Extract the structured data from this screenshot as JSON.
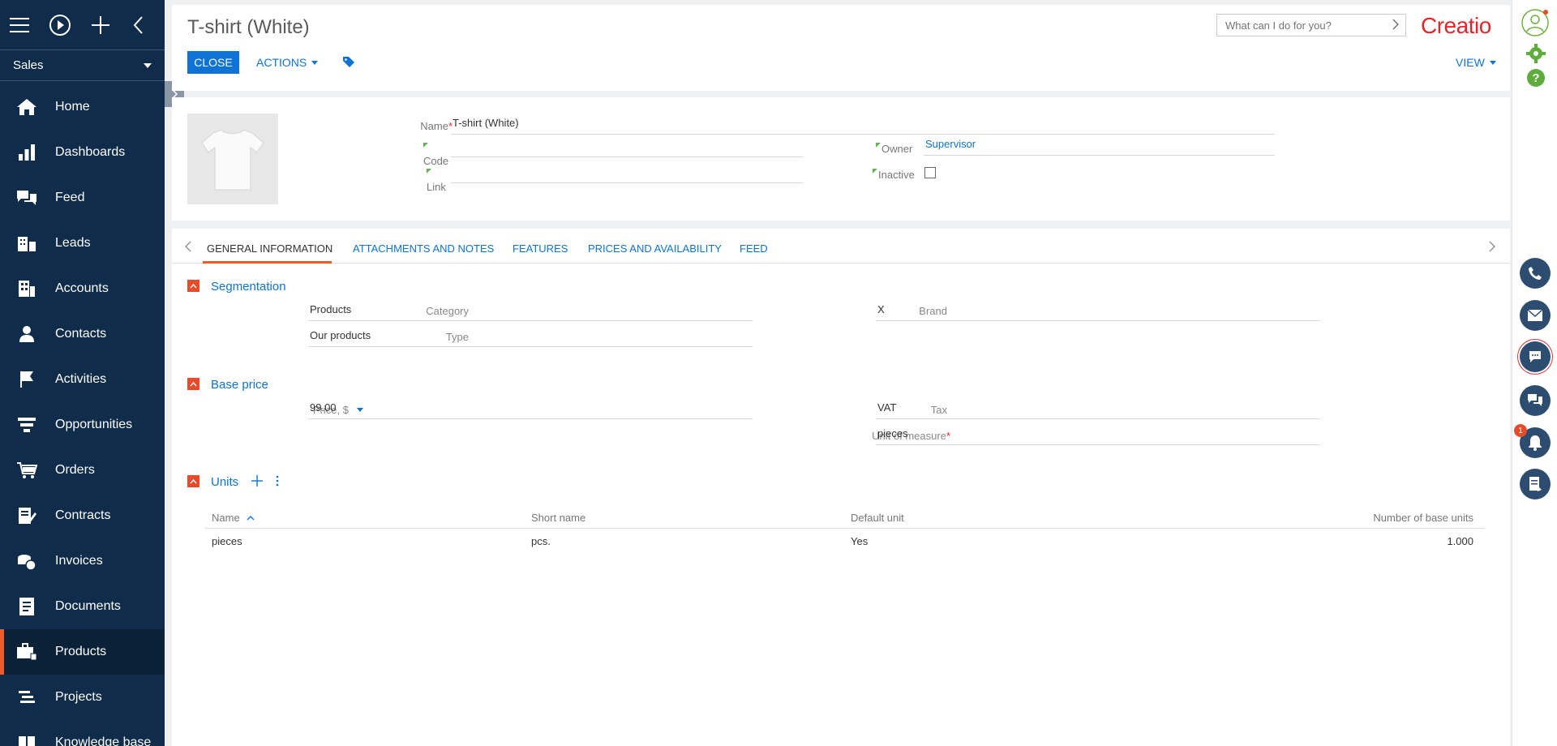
{
  "sidebar": {
    "workspace": "Sales",
    "items": [
      {
        "label": "Home"
      },
      {
        "label": "Dashboards"
      },
      {
        "label": "Feed"
      },
      {
        "label": "Leads"
      },
      {
        "label": "Accounts"
      },
      {
        "label": "Contacts"
      },
      {
        "label": "Activities"
      },
      {
        "label": "Opportunities"
      },
      {
        "label": "Orders"
      },
      {
        "label": "Contracts"
      },
      {
        "label": "Invoices"
      },
      {
        "label": "Documents"
      },
      {
        "label": "Products",
        "active": true
      },
      {
        "label": "Projects"
      },
      {
        "label": "Knowledge base"
      }
    ]
  },
  "header": {
    "title": "T-shirt (White)",
    "close_label": "CLOSE",
    "actions_label": "ACTIONS",
    "view_label": "VIEW",
    "search_placeholder": "What can I do for you?",
    "logo_text": "Creatio"
  },
  "profile": {
    "name_label": "Name",
    "name_value": "T-shirt (White)",
    "code_label": "Code",
    "code_value": "",
    "link_label": "Link",
    "link_value": "",
    "owner_label": "Owner",
    "owner_value": "Supervisor",
    "inactive_label": "Inactive",
    "inactive_checked": false
  },
  "tabs": [
    {
      "label": "GENERAL INFORMATION",
      "active": true
    },
    {
      "label": "ATTACHMENTS AND NOTES"
    },
    {
      "label": "FEATURES"
    },
    {
      "label": "PRICES AND AVAILABILITY"
    },
    {
      "label": "FEED"
    }
  ],
  "segmentation": {
    "title": "Segmentation",
    "category_label": "Category",
    "category_value": "Products",
    "type_label": "Type",
    "type_value": "Our products",
    "brand_label": "Brand",
    "brand_value": "X"
  },
  "base_price": {
    "title": "Base price",
    "price_label": "Price, $",
    "price_value": "99.00",
    "tax_label": "Tax",
    "tax_value": "VAT",
    "unit_label": "Unit of measure",
    "unit_value": "pieces"
  },
  "units": {
    "title": "Units",
    "columns": [
      "Name",
      "Short name",
      "Default unit",
      "Number of base units"
    ],
    "rows": [
      [
        "pieces",
        "pcs.",
        "Yes",
        "1.000"
      ]
    ]
  },
  "rail": {
    "notification_count": "1"
  },
  "colors": {
    "sidebar_bg": "#0f2c4a",
    "accent_blue": "#0e73d4",
    "accent_orange": "#f05a28",
    "brand_red": "#e3262b"
  }
}
